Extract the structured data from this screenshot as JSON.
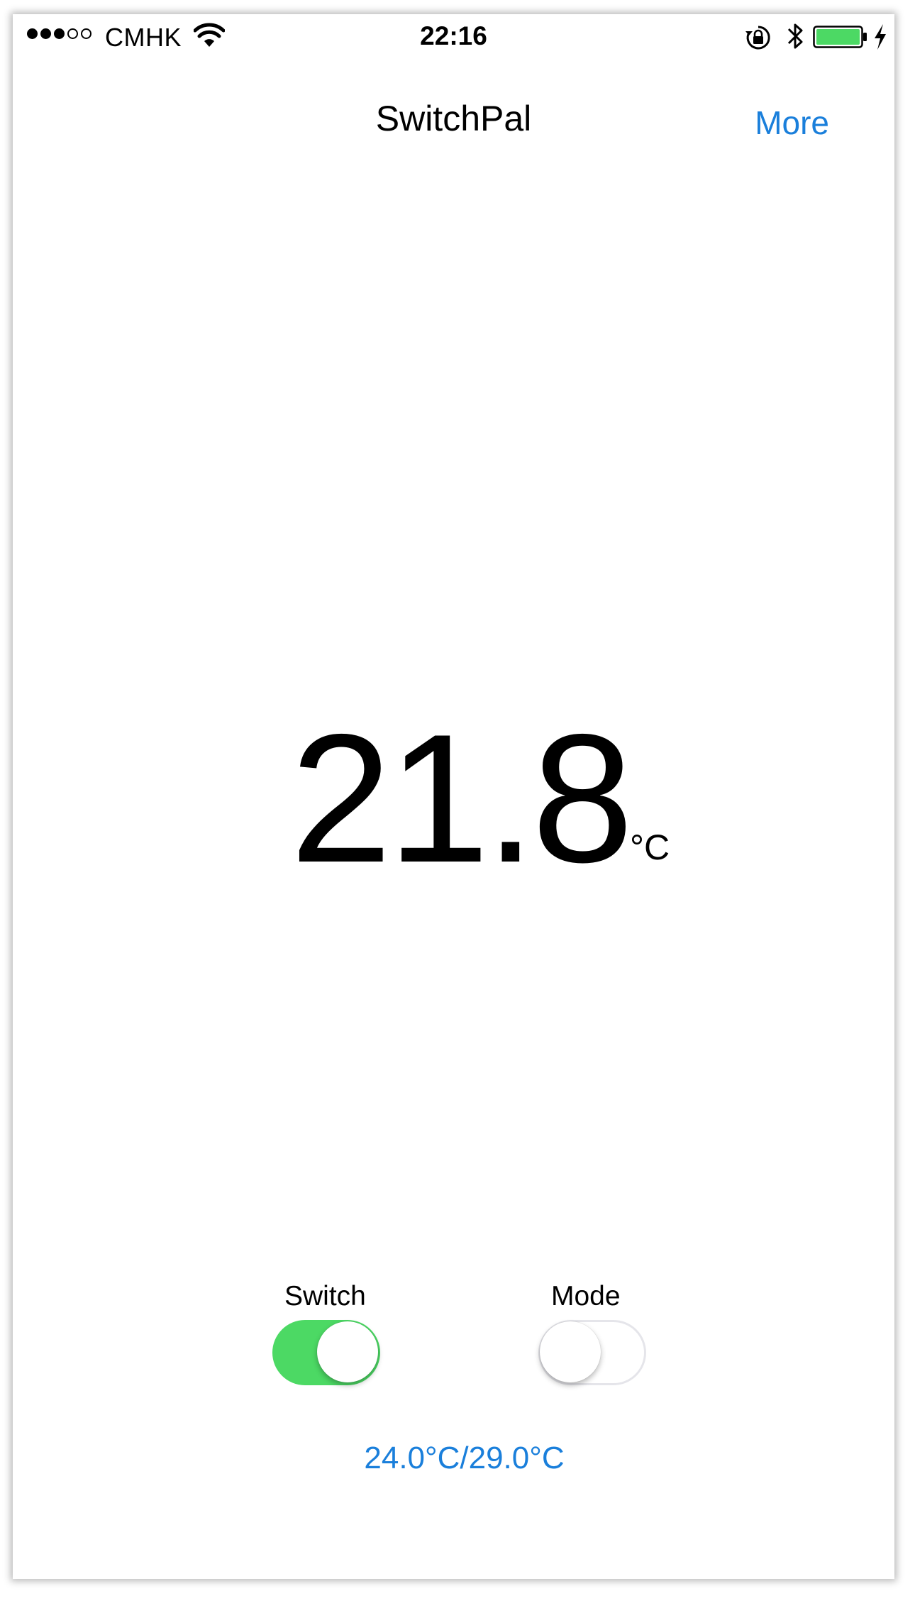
{
  "status_bar": {
    "carrier": "CMHK",
    "time": "22:16",
    "signal_bars_filled": 3,
    "signal_bars_total": 5,
    "icons": [
      "wifi-icon",
      "rotation-lock-icon",
      "bluetooth-icon",
      "battery-icon",
      "charging-bolt-icon"
    ],
    "battery_level": 1.0,
    "battery_color": "#4cd964"
  },
  "nav": {
    "title": "SwitchPal",
    "more_label": "More",
    "accent_color": "#1a7fdb"
  },
  "temperature": {
    "value": "21.8",
    "unit": "°C"
  },
  "controls": {
    "switch_label": "Switch",
    "switch_on": true,
    "switch_on_color": "#4cd964",
    "mode_label": "Mode",
    "mode_on": false
  },
  "range_text": "24.0°C/29.0°C"
}
